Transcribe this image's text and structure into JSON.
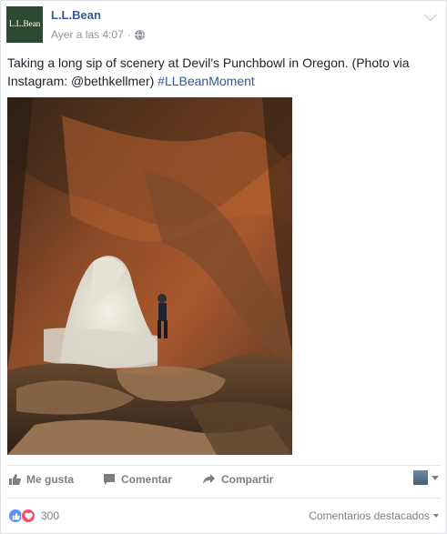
{
  "post": {
    "page_name": "L.L.Bean",
    "avatar_text": "L.L.Bean",
    "timestamp": "Ayer a las 4:07",
    "separator": "·",
    "privacy_icon": "globe-icon",
    "text_main": "Taking a long sip of scenery at Devil's Punchbowl in Oregon. (Photo via Instagram: @bethkellmer) ",
    "hashtag": "#LLBeanMoment",
    "photo_icon": "sea-cave-photo"
  },
  "actions": {
    "like_label": "Me gusta",
    "comment_label": "Comentar",
    "share_label": "Compartir"
  },
  "reactions": {
    "count": "300",
    "sort_label": "Comentarios destacados"
  },
  "colors": {
    "brand_link": "#365899",
    "avatar_bg": "#2b4a31",
    "like_blue": "#5890ff",
    "love_red": "#f25268"
  }
}
